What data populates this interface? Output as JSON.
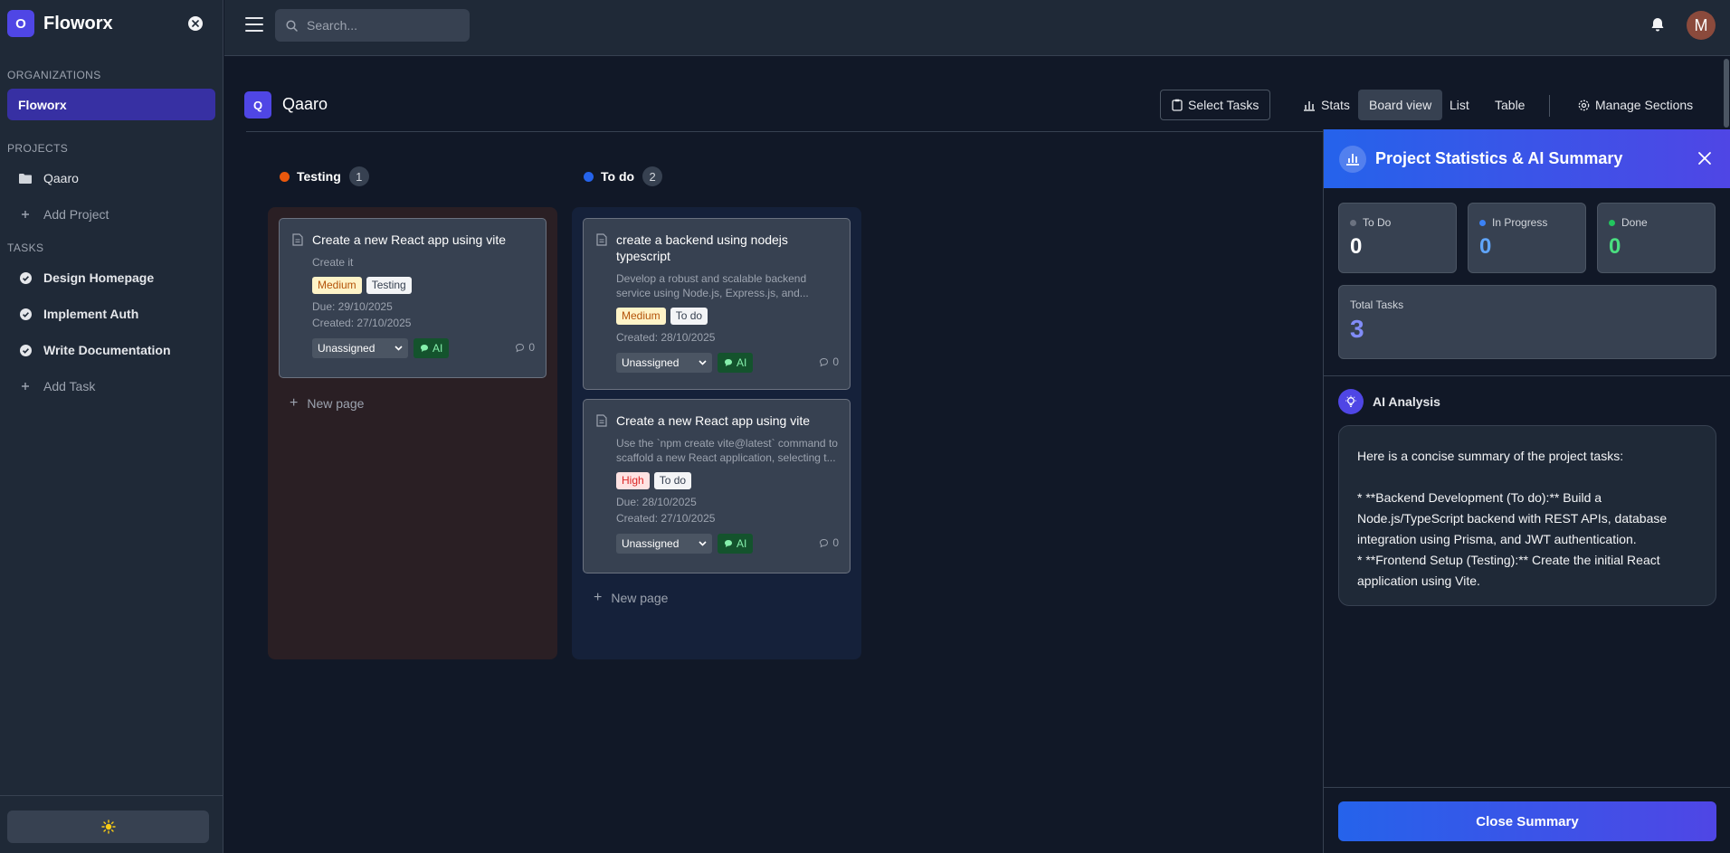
{
  "brand": {
    "logo": "O",
    "name": "Floworx"
  },
  "sidebar": {
    "organizations_label": "ORGANIZATIONS",
    "organizations": [
      {
        "label": "Floworx"
      }
    ],
    "projects_label": "PROJECTS",
    "projects": [
      {
        "label": "Qaaro",
        "icon": "folder-icon"
      }
    ],
    "add_project_label": "Add Project",
    "tasks_label": "TASKS",
    "tasks": [
      {
        "label": "Design Homepage",
        "icon": "check-circle-icon"
      },
      {
        "label": "Implement Auth",
        "icon": "check-circle-icon"
      },
      {
        "label": "Write Documentation",
        "icon": "check-circle-icon"
      }
    ],
    "add_task_label": "Add Task",
    "theme_icon": "sun-icon"
  },
  "topbar": {
    "search_placeholder": "Search...",
    "avatar_initial": "M"
  },
  "project": {
    "logo": "Q",
    "title": "Qaaro",
    "toolbar": {
      "select_tasks": "Select Tasks",
      "stats": "Stats",
      "board_view": "Board view",
      "list": "List",
      "table": "Table",
      "manage_sections": "Manage Sections"
    }
  },
  "columns": [
    {
      "name": "Testing",
      "count": "1",
      "color": "#ea580c",
      "new_page": "New page",
      "cards": [
        {
          "title": "Create a new React app using vite",
          "desc": "Create it",
          "priority": "Medium",
          "status": "Testing",
          "due": "Due: 29/10/2025",
          "created": "Created: 27/10/2025",
          "assignee": "Unassigned",
          "ai": "AI",
          "comments": "0"
        }
      ]
    },
    {
      "name": "To do",
      "count": "2",
      "color": "#2563eb",
      "new_page": "New page",
      "cards": [
        {
          "title": "create a backend using nodejs typescript",
          "desc": "Develop a robust and scalable backend service using Node.js, Express.js, and...",
          "priority": "Medium",
          "status": "To do",
          "created": "Created: 28/10/2025",
          "assignee": "Unassigned",
          "ai": "AI",
          "comments": "0"
        },
        {
          "title": "Create a new React app using vite",
          "desc": "Use the `npm create vite@latest` command to scaffold a new React application, selecting t...",
          "priority": "High",
          "status": "To do",
          "due": "Due: 28/10/2025",
          "created": "Created: 27/10/2025",
          "assignee": "Unassigned",
          "ai": "AI",
          "comments": "0"
        }
      ]
    }
  ],
  "summary": {
    "title": "Project Statistics & AI Summary",
    "stats": [
      {
        "label": "To Do",
        "value": "0",
        "color": "#6b7280",
        "value_color": "#ffffff"
      },
      {
        "label": "In Progress",
        "value": "0",
        "color": "#3b82f6",
        "value_color": "#60a5fa"
      },
      {
        "label": "Done",
        "value": "0",
        "color": "#22c55e",
        "value_color": "#4ade80"
      }
    ],
    "total_label": "Total Tasks",
    "total_value": "3",
    "ai_title": "AI Analysis",
    "ai_text": {
      "intro": "Here is a concise summary of the project tasks:",
      "line1": "*   **Backend Development (To do):** Build a Node.js/TypeScript backend with REST APIs, database integration using Prisma, and JWT authentication.",
      "line2": "*   **Frontend Setup (Testing):** Create the initial React application using Vite."
    },
    "close_label": "Close Summary"
  }
}
